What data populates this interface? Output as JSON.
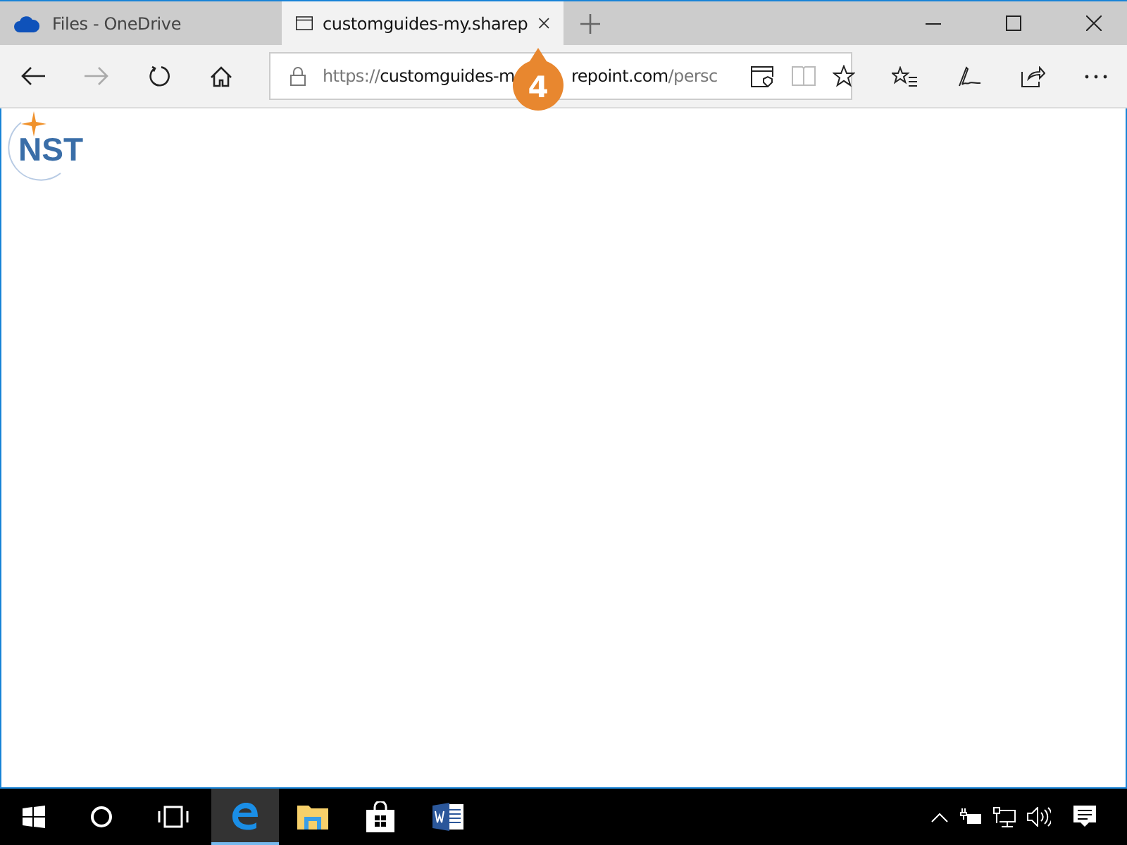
{
  "tabs": [
    {
      "label": "Files - OneDrive",
      "selected": false
    },
    {
      "label": "customguides-my.sharep",
      "selected": true
    }
  ],
  "address": {
    "scheme": "https://",
    "host_start": "customguides-m",
    "host_end": "repoint.com",
    "path": "/persc"
  },
  "callout": {
    "number": "4"
  },
  "logo": {
    "text": "NST"
  },
  "taskbar": {
    "apps": [
      {
        "kind": "edge",
        "active": true
      },
      {
        "kind": "folder",
        "active": false
      },
      {
        "kind": "store",
        "active": false
      },
      {
        "kind": "word",
        "active": false
      }
    ]
  }
}
